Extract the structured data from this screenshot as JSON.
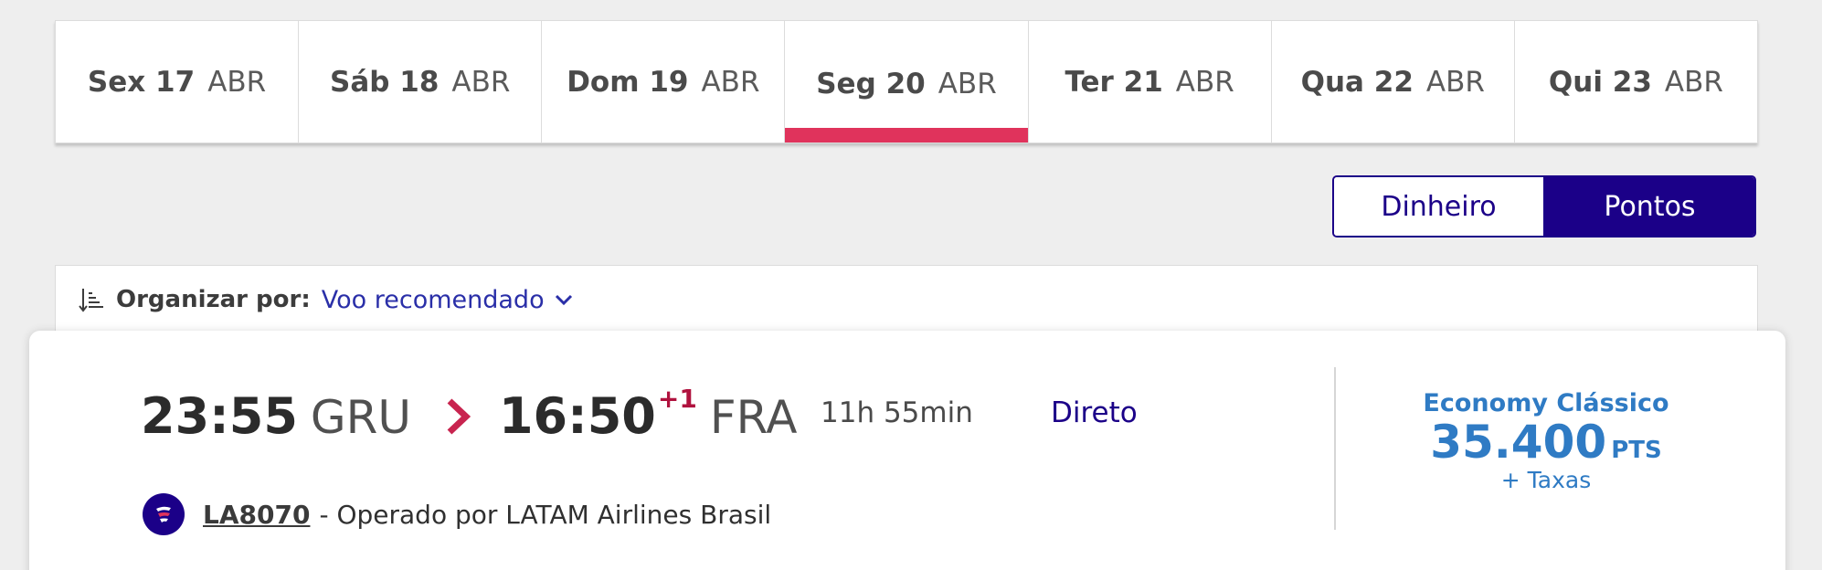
{
  "date_tabs": [
    {
      "day": "Sex 17",
      "month": "ABR",
      "selected": false
    },
    {
      "day": "Sáb 18",
      "month": "ABR",
      "selected": false
    },
    {
      "day": "Dom 19",
      "month": "ABR",
      "selected": false
    },
    {
      "day": "Seg 20",
      "month": "ABR",
      "selected": true
    },
    {
      "day": "Ter 21",
      "month": "ABR",
      "selected": false
    },
    {
      "day": "Qua 22",
      "month": "ABR",
      "selected": false
    },
    {
      "day": "Qui 23",
      "month": "ABR",
      "selected": false
    }
  ],
  "payment_toggle": {
    "money_label": "Dinheiro",
    "points_label": "Pontos",
    "selected": "Pontos"
  },
  "sort": {
    "label": "Organizar por:",
    "value": "Voo recomendado",
    "icon": "sort-icon"
  },
  "flight": {
    "departure_time": "23:55",
    "departure_airport": "GRU",
    "arrival_time": "16:50",
    "arrival_day_offset": "+1",
    "arrival_airport": "FRA",
    "duration": "11h 55min",
    "stops": "Direto",
    "flight_number": "LA8070",
    "operator": "- Operado por LATAM Airlines Brasil",
    "fare": {
      "cabin": "Economy Clássico",
      "price": "35.400",
      "unit": "PTS",
      "taxes": "+ Taxas"
    }
  },
  "colors": {
    "accent": "#e0335c",
    "brand": "#1b0088",
    "price": "#2f7bc4",
    "offset": "#b0123e"
  }
}
